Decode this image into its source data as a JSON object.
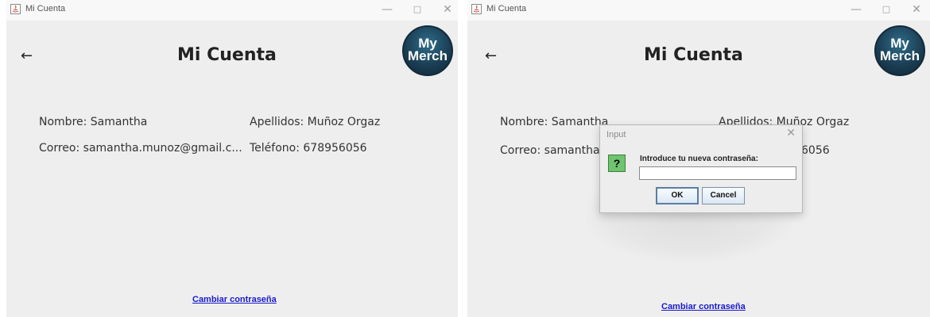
{
  "left_window": {
    "title": "Mi Cuenta",
    "controls": {
      "minimize": "—",
      "maximize": "□",
      "close": "✕"
    },
    "back_glyph": "←",
    "heading": "Mi Cuenta",
    "logo": {
      "line1": "My",
      "line2": "Merch"
    },
    "nombre": "Nombre: Samantha",
    "apellidos": "Apellidos: Muñoz Orgaz",
    "correo": "Correo: samantha.munoz@gmail.c...",
    "telefono": "Teléfono: 678956056",
    "change_password_link": "Cambiar contraseña"
  },
  "right_window": {
    "title": "Mi Cuenta",
    "controls": {
      "minimize": "—",
      "maximize": "□",
      "close": "✕"
    },
    "back_glyph": "←",
    "heading": "Mi Cuenta",
    "logo": {
      "line1": "My",
      "line2": "Merch"
    },
    "nombre": "Nombre: Samantha",
    "apellidos_visible": "Apellidos: Muñoz Orgaz",
    "correo_visible": "Correo: samantha.m",
    "telefono_visible": "6056",
    "change_password_link": "Cambiar contraseña",
    "dialog": {
      "title": "Input",
      "close": "✕",
      "icon_glyph": "?",
      "prompt": "Introduce tu nueva contraseña:",
      "input_value": "",
      "ok_label": "OK",
      "cancel_label": "Cancel"
    }
  },
  "colors": {
    "window_bg": "#eeeeee",
    "link": "#1a1acc",
    "logo_bg": "#1b3f55",
    "question_icon": "#6fc46f"
  }
}
